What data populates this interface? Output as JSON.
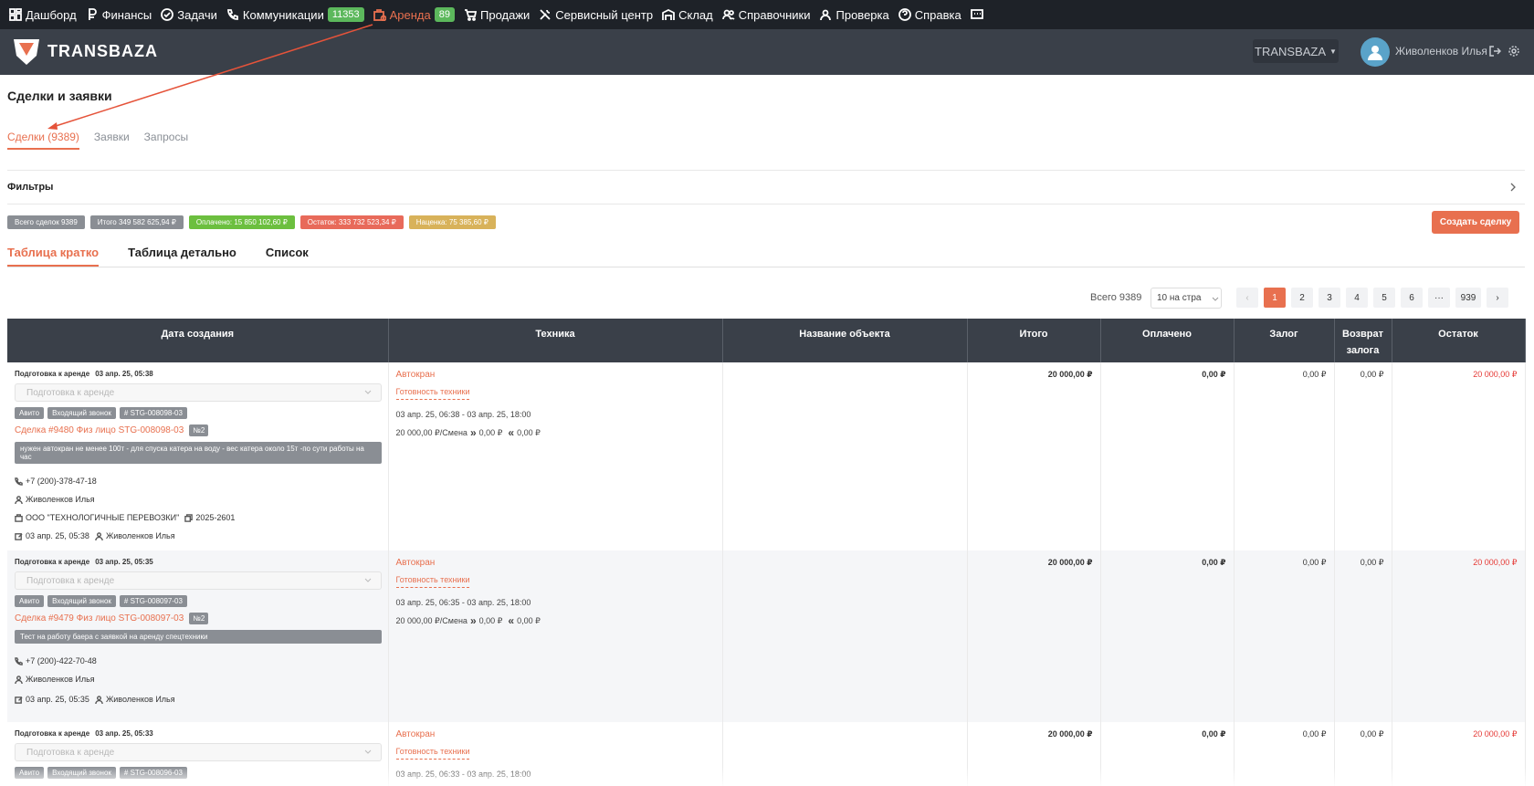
{
  "nav": {
    "items": [
      {
        "label": "Дашборд",
        "icon": "dashboard-icon"
      },
      {
        "label": "Финансы",
        "icon": "ruble-icon"
      },
      {
        "label": "Задачи",
        "icon": "check-circle-icon"
      },
      {
        "label": "Коммуникации",
        "icon": "phone-icon",
        "badge": "11353"
      },
      {
        "label": "Аренда",
        "icon": "rent-icon",
        "badge": "89",
        "active": true
      },
      {
        "label": "Продажи",
        "icon": "cart-icon"
      },
      {
        "label": "Сервисный центр",
        "icon": "tools-icon"
      },
      {
        "label": "Склад",
        "icon": "warehouse-icon"
      },
      {
        "label": "Справочники",
        "icon": "users-icon"
      },
      {
        "label": "Проверка",
        "icon": "user-check-icon"
      },
      {
        "label": "Справка",
        "icon": "help-icon"
      }
    ]
  },
  "header": {
    "logo_text": "TRANSBAZA",
    "company": "TRANSBAZA",
    "user_name": "Живоленков Илья"
  },
  "page": {
    "title": "Сделки и заявки",
    "deal_tabs": [
      "Сделки (9389)",
      "Заявки",
      "Запросы"
    ],
    "filters_label": "Фильтры"
  },
  "chips": [
    {
      "label": "Всего сделок 9389",
      "color": "#8a8e94"
    },
    {
      "label": "Итого 349 582 625,94 ₽",
      "color": "#8a8e94"
    },
    {
      "label": "Оплачено: 15 850 102,60 ₽",
      "color": "#6cbf3f"
    },
    {
      "label": "Остаток: 333 732 523,34 ₽",
      "color": "#e86a5a"
    },
    {
      "label": "Наценка: 75 385,60 ₽",
      "color": "#d8b25a"
    }
  ],
  "create_button": "Создать сделку",
  "view_tabs": [
    "Таблица кратко",
    "Таблица детально",
    "Список"
  ],
  "pagination": {
    "total": "Всего 9389",
    "per_page": "10 на стра",
    "pages": [
      "1",
      "2",
      "3",
      "4",
      "5",
      "6",
      "···",
      "939"
    ],
    "current": "1"
  },
  "table": {
    "columns": [
      "Дата создания",
      "Техника",
      "Название объекта",
      "Итого",
      "Оплачено",
      "Залог",
      "Возврат залога",
      "Остаток"
    ],
    "rows": [
      {
        "status": "Подготовка к аренде",
        "created": "03 апр. 25, 05:38",
        "stage_placeholder": "Подготовка к аренде",
        "tags": [
          "Авито",
          "Входящий звонок",
          "# STG-008098-03"
        ],
        "deal": "Сделка #9480 Физ лицо STG-008098-03",
        "deal_badge": "№2",
        "comment": "нужен автокран не менее 100т - для спуска катера на воду - вес катера около 15т -по сути работы на час",
        "phone": "+7 (200)-378-47-18",
        "manager": "Живоленков Илья",
        "company": "ООО \"ТЕХНОЛОГИЧНЫЕ ПЕРЕВОЗКИ\"",
        "contract": "2025-2601",
        "edited": "03 апр. 25, 05:38",
        "editor": "Живоленков Илья",
        "tech": "Автокран",
        "tech_status": "Готовность техники",
        "tech_dates": "03 апр. 25, 06:38 - 03 апр. 25, 18:00",
        "tech_price": "20 000,00 ₽/Смена",
        "tech_paid": "0,00 ₽",
        "tech_return": "0,00 ₽",
        "object": "",
        "total": "20 000,00 ₽",
        "paid": "0,00 ₽",
        "deposit": "0,00 ₽",
        "deposit_return": "0,00 ₽",
        "rest": "20 000,00 ₽"
      },
      {
        "status": "Подготовка к аренде",
        "created": "03 апр. 25, 05:35",
        "stage_placeholder": "Подготовка к аренде",
        "tags": [
          "Авито",
          "Входящий звонок",
          "# STG-008097-03"
        ],
        "deal": "Сделка #9479 Физ лицо STG-008097-03",
        "deal_badge": "№2",
        "comment": "Тест на работу баера с заявкой на аренду спецтехники",
        "phone": "+7 (200)-422-70-48",
        "manager": "Живоленков Илья",
        "edited": "03 апр. 25, 05:35",
        "editor": "Живоленков Илья",
        "tech": "Автокран",
        "tech_status": "Готовность техники",
        "tech_dates": "03 апр. 25, 06:35 - 03 апр. 25, 18:00",
        "tech_price": "20 000,00 ₽/Смена",
        "tech_paid": "0,00 ₽",
        "tech_return": "0,00 ₽",
        "object": "",
        "total": "20 000,00 ₽",
        "paid": "0,00 ₽",
        "deposit": "0,00 ₽",
        "deposit_return": "0,00 ₽",
        "rest": "20 000,00 ₽"
      },
      {
        "status": "Подготовка к аренде",
        "created": "03 апр. 25, 05:33",
        "stage_placeholder": "Подготовка к аренде",
        "tags": [
          "Авито",
          "Входящий звонок",
          "# STG-008096-03"
        ],
        "tech": "Автокран",
        "tech_status": "Готовность техники",
        "tech_dates": "03 апр. 25, 06:33 - 03 апр. 25, 18:00",
        "object": "",
        "total": "20 000,00 ₽",
        "paid": "0,00 ₽",
        "deposit": "0,00 ₽",
        "deposit_return": "0,00 ₽",
        "rest": "20 000,00 ₽"
      }
    ]
  }
}
